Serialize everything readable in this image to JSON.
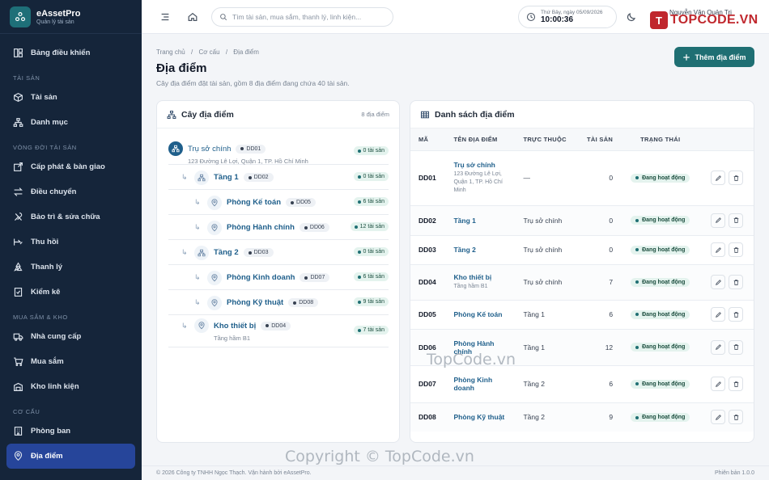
{
  "brand": {
    "name": "eAssetPro",
    "subtitle": "Quản lý tài sản"
  },
  "sidebar": {
    "items": [
      {
        "label": "Bảng điều khiển",
        "icon": "dashboard-icon"
      },
      {
        "section": "TÀI SẢN"
      },
      {
        "label": "Tài sản",
        "icon": "box-icon"
      },
      {
        "label": "Danh mục",
        "icon": "category-icon"
      },
      {
        "section": "VÒNG ĐỜI TÀI SẢN"
      },
      {
        "label": "Cấp phát & bàn giao",
        "icon": "handover-icon"
      },
      {
        "label": "Điều chuyển",
        "icon": "transfer-icon"
      },
      {
        "label": "Bảo trì & sửa chữa",
        "icon": "tools-icon"
      },
      {
        "label": "Thu hồi",
        "icon": "return-icon"
      },
      {
        "label": "Thanh lý",
        "icon": "recycle-icon"
      },
      {
        "label": "Kiểm kê",
        "icon": "checklist-icon"
      },
      {
        "section": "MUA SẮM & KHO"
      },
      {
        "label": "Nhà cung cấp",
        "icon": "truck-icon"
      },
      {
        "label": "Mua sắm",
        "icon": "cart-icon"
      },
      {
        "label": "Kho linh kiện",
        "icon": "warehouse-icon"
      },
      {
        "section": "CƠ CẤU"
      },
      {
        "label": "Phòng ban",
        "icon": "building-icon"
      },
      {
        "label": "Địa điểm",
        "icon": "location-icon",
        "active": true
      }
    ]
  },
  "topbar": {
    "search_placeholder": "Tìm tài sản, mua sắm, thanh lý, linh kiện...",
    "clock_date": "Thứ Bảy, ngày 05/09/2026",
    "clock_time": "10:00:36",
    "user_name": "Nguyễn Văn Quản Trị",
    "watermark": "TOPCODE.VN",
    "watermark_badge": "T"
  },
  "page": {
    "breadcrumb": [
      "Trang chủ",
      "Cơ cấu",
      "Địa điểm"
    ],
    "title": "Địa điểm",
    "subtitle": "Cây địa điểm đặt tài sản, gồm 8 địa điểm đang chứa 40 tài sản.",
    "add_button": "Thêm địa điểm"
  },
  "tree": {
    "title": "Cây địa điểm",
    "count": "8 địa điểm",
    "nodes": [
      {
        "name": "Trụ sở chính",
        "code": "DD01",
        "address": "123 Đường Lê Lợi, Quận 1, TP. Hồ Chí Minh",
        "assets": "0 tài sản",
        "level": 0,
        "icon": "building"
      },
      {
        "name": "Tầng 1",
        "code": "DD02",
        "address": "",
        "assets": "0 tài sản",
        "level": 1,
        "icon": "floor"
      },
      {
        "name": "Phòng Kế toán",
        "code": "DD05",
        "address": "",
        "assets": "6 tài sản",
        "level": 2,
        "icon": "pin"
      },
      {
        "name": "Phòng Hành chính",
        "code": "DD06",
        "address": "",
        "assets": "12 tài sản",
        "level": 2,
        "icon": "pin"
      },
      {
        "name": "Tầng 2",
        "code": "DD03",
        "address": "",
        "assets": "0 tài sản",
        "level": 1,
        "icon": "floor"
      },
      {
        "name": "Phòng Kinh doanh",
        "code": "DD07",
        "address": "",
        "assets": "6 tài sản",
        "level": 2,
        "icon": "pin"
      },
      {
        "name": "Phòng Kỹ thuật",
        "code": "DD08",
        "address": "",
        "assets": "9 tài sản",
        "level": 2,
        "icon": "pin"
      },
      {
        "name": "Kho thiết bị",
        "code": "DD04",
        "address": "Tầng hầm B1",
        "assets": "7 tài sản",
        "level": 1,
        "icon": "pin"
      }
    ]
  },
  "table": {
    "title": "Danh sách địa điểm",
    "headers": [
      "MÃ",
      "TÊN ĐỊA ĐIỂM",
      "TRỰC THUỘC",
      "TÀI SẢN",
      "TRẠNG THÁI"
    ],
    "rows": [
      {
        "code": "DD01",
        "name": "Trụ sở chính",
        "sub": "123 Đường Lê Lợi, Quận 1, TP. Hồ Chí Minh",
        "parent": "—",
        "assets": "0",
        "status": "Đang hoạt động"
      },
      {
        "code": "DD02",
        "name": "Tầng 1",
        "sub": "",
        "parent": "Trụ sở chính",
        "assets": "0",
        "status": "Đang hoạt động"
      },
      {
        "code": "DD03",
        "name": "Tầng 2",
        "sub": "",
        "parent": "Trụ sở chính",
        "assets": "0",
        "status": "Đang hoạt động"
      },
      {
        "code": "DD04",
        "name": "Kho thiết bị",
        "sub": "Tầng hầm B1",
        "parent": "Trụ sở chính",
        "assets": "7",
        "status": "Đang hoạt động"
      },
      {
        "code": "DD05",
        "name": "Phòng Kế toán",
        "sub": "",
        "parent": "Tầng 1",
        "assets": "6",
        "status": "Đang hoạt động"
      },
      {
        "code": "DD06",
        "name": "Phòng Hành chính",
        "sub": "",
        "parent": "Tầng 1",
        "assets": "12",
        "status": "Đang hoạt động"
      },
      {
        "code": "DD07",
        "name": "Phòng Kinh doanh",
        "sub": "",
        "parent": "Tầng 2",
        "assets": "6",
        "status": "Đang hoạt động"
      },
      {
        "code": "DD08",
        "name": "Phòng Kỹ thuật",
        "sub": "",
        "parent": "Tầng 2",
        "assets": "9",
        "status": "Đang hoạt động"
      }
    ]
  },
  "footer": {
    "copyright": "© 2026 Công ty TNHH Ngọc Thạch. Vận hành bởi eAssetPro.",
    "version": "Phiên bản 1.0.0"
  },
  "watermarks": {
    "center": "TopCode.vn",
    "bottom": "Copyright © TopCode.vn"
  }
}
